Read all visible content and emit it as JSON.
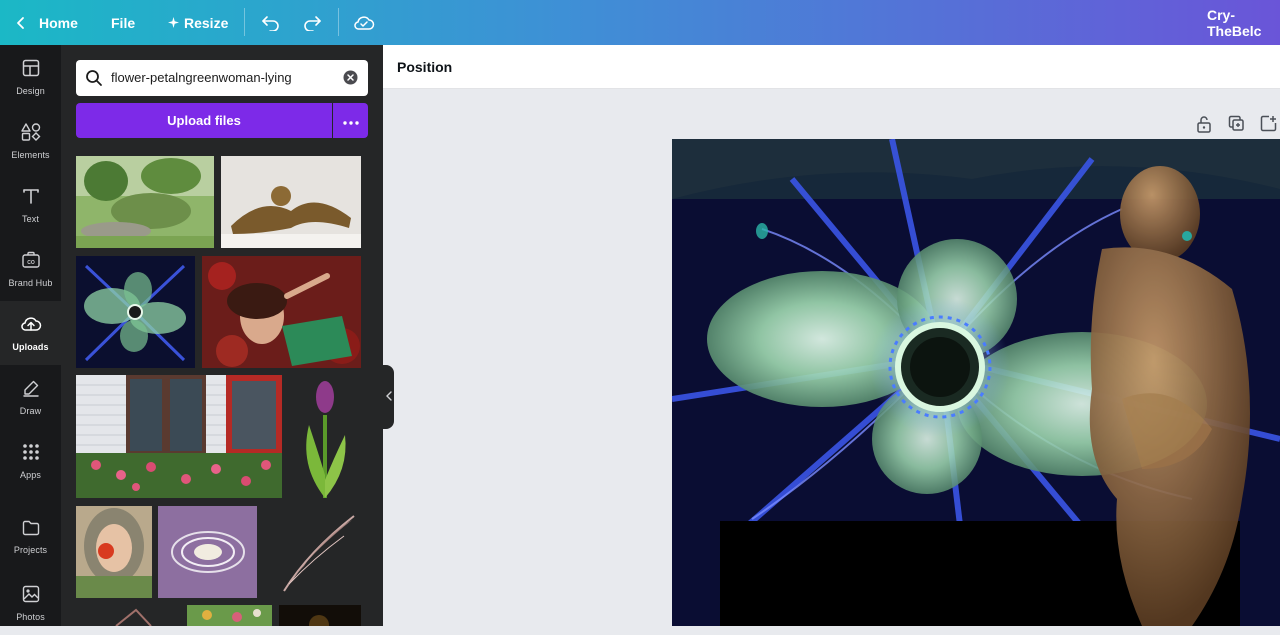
{
  "topbar": {
    "home_label": "Home",
    "file_label": "File",
    "resize_label": "Resize",
    "doc_title": "Cry-TheBelc"
  },
  "colors": {
    "accent": "#7d2ae8",
    "topbar_start": "#1bb8c6",
    "topbar_end": "#6a55d8",
    "rail_bg": "#18191b",
    "panel_bg": "#252627"
  },
  "rail": {
    "items": [
      {
        "label": "Design",
        "icon": "layout-icon"
      },
      {
        "label": "Elements",
        "icon": "shapes-icon"
      },
      {
        "label": "Text",
        "icon": "text-icon"
      },
      {
        "label": "Brand Hub",
        "icon": "brand-icon"
      },
      {
        "label": "Uploads",
        "icon": "cloud-upload-icon",
        "active": true
      },
      {
        "label": "Draw",
        "icon": "pen-icon"
      },
      {
        "label": "Apps",
        "icon": "grid-icon"
      },
      {
        "label": "Projects",
        "icon": "folder-icon"
      },
      {
        "label": "Photos",
        "icon": "photo-icon"
      }
    ]
  },
  "panel": {
    "search_value": "flower-petalngreenwoman-lying",
    "upload_label": "Upload files"
  },
  "context_bar": {
    "position_label": "Position"
  }
}
